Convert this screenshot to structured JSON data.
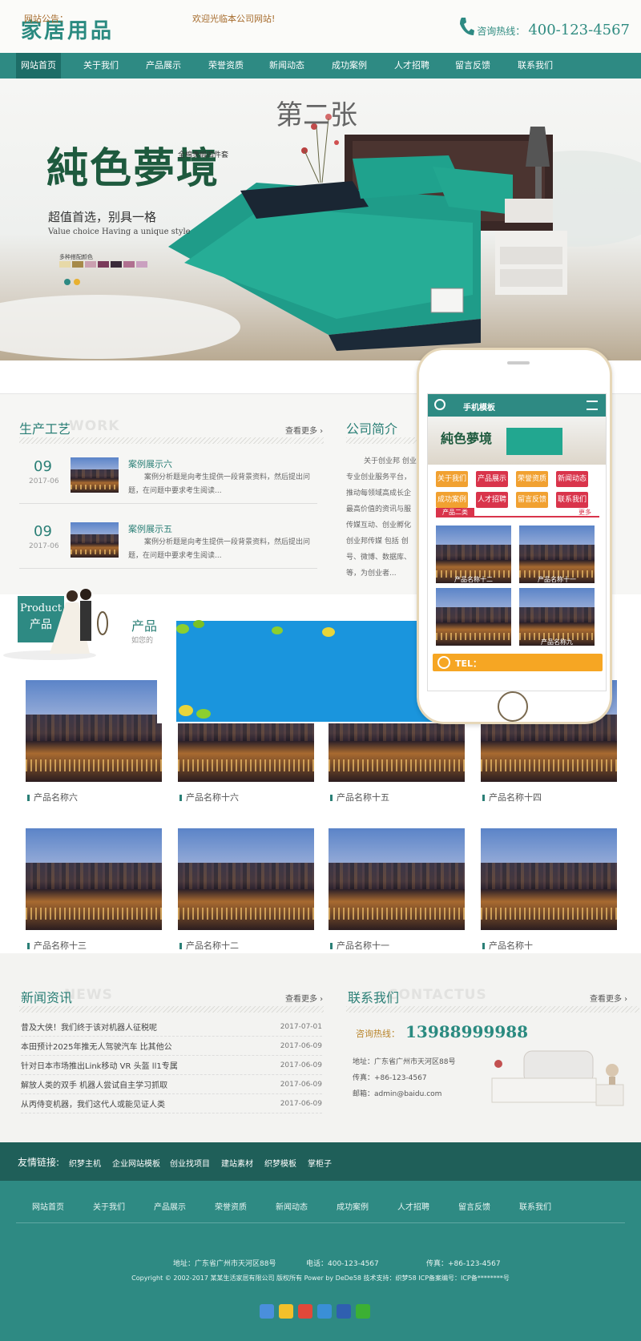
{
  "header": {
    "logo": "家居用品",
    "hotline_label": "咨询热线：",
    "hotline_number": "400-123-4567"
  },
  "nav": {
    "items": [
      "网站首页",
      "关于我们",
      "产品展示",
      "荣誉资质",
      "新闻动态",
      "成功案例",
      "人才招聘",
      "留言反馈",
      "联系我们"
    ],
    "active_index": 0
  },
  "banner": {
    "overlay_text": "第二张",
    "title": "純色夢境",
    "small_tag": "全棉贵缎四件套",
    "subtitle": "超值首选，别具一格",
    "subtitle_en": "Value choice Having a unique style",
    "swatch_label": "多种搭配颜色"
  },
  "notice": {
    "label": "网站公告：",
    "text": "欢迎光临本公司网站!"
  },
  "process": {
    "title": "生产工艺",
    "ghost": "WORK",
    "more": "查看更多 ›",
    "items": [
      {
        "day": "09",
        "ym": "2017-06",
        "title": "案例展示六",
        "desc": "案例分析题是向考生提供一段背景资料，然后提出问题，在问题中要求考生阅读..."
      },
      {
        "day": "09",
        "ym": "2017-06",
        "title": "案例展示五",
        "desc": "案例分析题是向考生提供一段背景资料，然后提出问题，在问题中要求考生阅读..."
      }
    ]
  },
  "about": {
    "title": "公司简介",
    "text_lines": [
      "关于创业邦 创业",
      "专业创业服务平台，",
      "推动每领域高成长企",
      "最高价值的资讯与服",
      "传媒互动、创业孵化",
      "创业邦传媒 包括 创",
      "号、微博、数据库、",
      "等，为创业者..."
    ]
  },
  "product_section": {
    "badge_en": "Product",
    "badge_cn": "产品",
    "title": "产品",
    "sub": "如您的",
    "row1": [
      "产品名称六",
      "产品名称十六",
      "产品名称十五",
      "产品名称十四"
    ],
    "row2": [
      "产品名称十三",
      "产品名称十二",
      "产品名称十一",
      "产品名称十"
    ]
  },
  "news": {
    "title": "新闻资讯",
    "ghost": "NEWS",
    "more": "查看更多 ›",
    "items": [
      {
        "text": "昔及大侠！我们终于该对机器人征税呢",
        "date": "2017-07-01"
      },
      {
        "text": "本田预计2025年推无人驾驶汽车 比其他公",
        "date": "2017-06-09"
      },
      {
        "text": "针对日本市场推出Link移动 VR 头盔 ll1专属",
        "date": "2017-06-09"
      },
      {
        "text": "解放人类的双手 机器人尝试自主学习抓取",
        "date": "2017-06-09"
      },
      {
        "text": "从丙侍变机器，我们这代人或能见证人类",
        "date": "2017-06-09"
      }
    ]
  },
  "contact": {
    "title": "联系我们",
    "ghost": "CONTACTUS",
    "more": "查看更多 ›",
    "hotline_label": "咨询热线：",
    "hotline": "13988999988",
    "address": "地址：广东省广州市天河区88号",
    "fax": "传真：+86-123-4567",
    "email": "邮箱：admin@baidu.com"
  },
  "links": {
    "label": "友情链接:",
    "items": [
      "织梦主机",
      "企业网站模板",
      "创业找项目",
      "建站素材",
      "织梦模板",
      "掌柜子"
    ]
  },
  "footer": {
    "nav": [
      "网站首页",
      "关于我们",
      "产品展示",
      "荣誉资质",
      "新闻动态",
      "成功案例",
      "人才招聘",
      "留言反馈",
      "联系我们"
    ],
    "address": "地址：广东省广州市天河区88号",
    "phone": "电话：400-123-4567",
    "fax": "传真：+86-123-4567",
    "copyright": "Copyright © 2002-2017 某某生活家居有限公司 版权所有 Power by DeDe58 技术支持：织梦58 ICP备案编号：ICP备********号"
  },
  "mobile": {
    "title": "手机模板",
    "buttons": [
      "关于我们",
      "产品展示",
      "荣誉资质",
      "新闻动态",
      "成功案例",
      "人才招聘",
      "留言反馈",
      "联系我们"
    ],
    "cat_label": "产品二类",
    "cat_more": "更多",
    "products": [
      "产品名称十二",
      "产品名称十一",
      "",
      "产品名称九"
    ],
    "tel": "TEL："
  },
  "colors": {
    "brand": "#2e8a83",
    "dark": "#1f5f59",
    "accent_gold": "#a66b2c"
  }
}
